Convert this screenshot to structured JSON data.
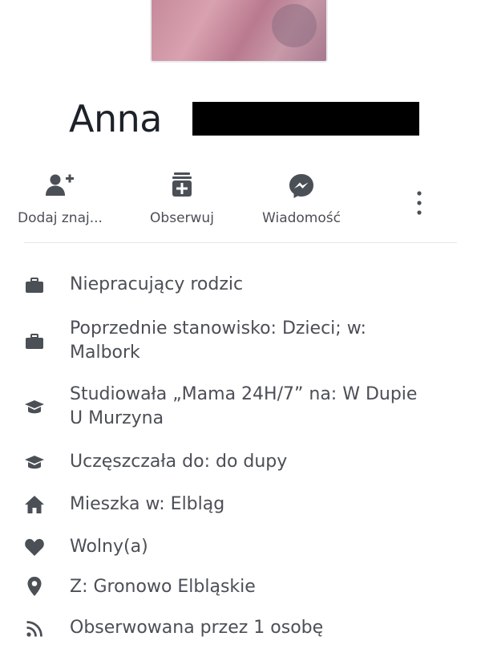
{
  "profile": {
    "first_name": "Anna"
  },
  "actions": [
    {
      "label": "Dodaj znaj...",
      "icon": "add-friend-icon"
    },
    {
      "label": "Obserwuj",
      "icon": "follow-icon"
    },
    {
      "label": "Wiadomość",
      "icon": "messenger-icon"
    }
  ],
  "more_icon": "more-vertical-icon",
  "details": [
    {
      "icon": "briefcase-icon",
      "text": "Niepracujący rodzic"
    },
    {
      "icon": "briefcase-icon",
      "text": "Poprzednie stanowisko: Dzieci; w: Malbork"
    },
    {
      "icon": "graduation-cap-icon",
      "text": "Studiowała „Mama 24H/7”  na: W Dupie U Murzyna"
    },
    {
      "icon": "graduation-cap-icon",
      "text": "Uczęszczała do: do dupy"
    },
    {
      "icon": "home-icon",
      "text": "Mieszka w: Elbląg"
    },
    {
      "icon": "heart-icon",
      "text": "Wolny(a)"
    },
    {
      "icon": "location-pin-icon",
      "text": "Z: Gronowo Elbląskie"
    },
    {
      "icon": "rss-follow-icon",
      "text": "Obserwowana przez 1 osobę"
    }
  ],
  "colors": {
    "icon": "#4b4f56",
    "text": "#4b4f56",
    "name": "#1d2129",
    "divider": "#e6e8eb"
  }
}
